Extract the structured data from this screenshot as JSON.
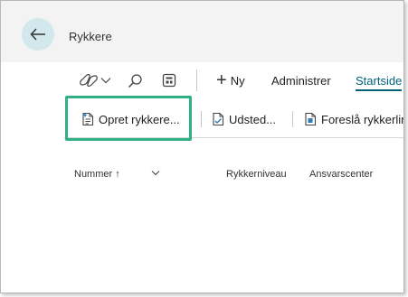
{
  "header": {
    "title": "Rykkere"
  },
  "actionbar": {
    "new_symbol": "+",
    "new_label": "Ny",
    "manage_label": "Administrer",
    "home_label": "Startside"
  },
  "subbar": {
    "create_label": "Opret rykkere...",
    "issue_label": "Udsted...",
    "suggest_label": "Foreslå rykkerlinjer"
  },
  "columns": {
    "number": "Nummer",
    "sort_arrow": "↑",
    "level": "Rykkerniveau",
    "center": "Ansvarscenter"
  },
  "colors": {
    "accent": "#00607a",
    "highlight": "#2fb182",
    "header_bg": "#f3f3f3",
    "back_button_bg": "#d2e8ec"
  },
  "icons": [
    "back-arrow-icon",
    "copilot-icon",
    "chevron-down-icon",
    "search-icon",
    "layout-icon",
    "create-document-icon",
    "issue-document-icon",
    "suggest-document-icon"
  ]
}
